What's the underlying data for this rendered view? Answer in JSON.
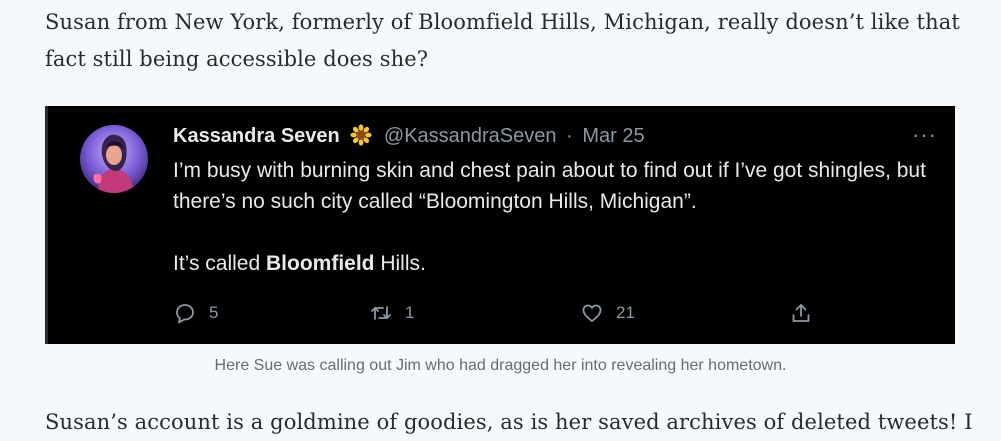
{
  "article": {
    "paragraph_top": "Susan from New York, formerly of Bloomfield Hills, Michigan, really doesn’t like that fact still being accessible does she?",
    "paragraph_bottom": "Susan’s account is a goldmine of goodies, as is her saved archives of deleted tweets! I",
    "caption": "Here Sue was calling out Jim who had dragged her into revealing her hometown."
  },
  "tweet": {
    "display_name": "Kassandra Seven",
    "name_emoji": "sunflower-icon",
    "handle": "@KassandraSeven",
    "separator": "·",
    "date": "Mar 25",
    "more": "···",
    "text_line1": "I’m busy with burning skin and chest pain about to find out if I’ve got shingles, but there’s no such city called “Bloomington Hills, Michigan”.",
    "text_line2_prefix": "It’s called ",
    "text_line2_bold": "Bloomfield",
    "text_line2_suffix": " Hills.",
    "replies": "5",
    "retweets": "1",
    "likes": "21"
  },
  "colors": {
    "page_bg": "#f5f9fb",
    "tweet_bg": "#000000",
    "tweet_text": "#e7e9ea",
    "tweet_muted": "#8b98a5"
  }
}
